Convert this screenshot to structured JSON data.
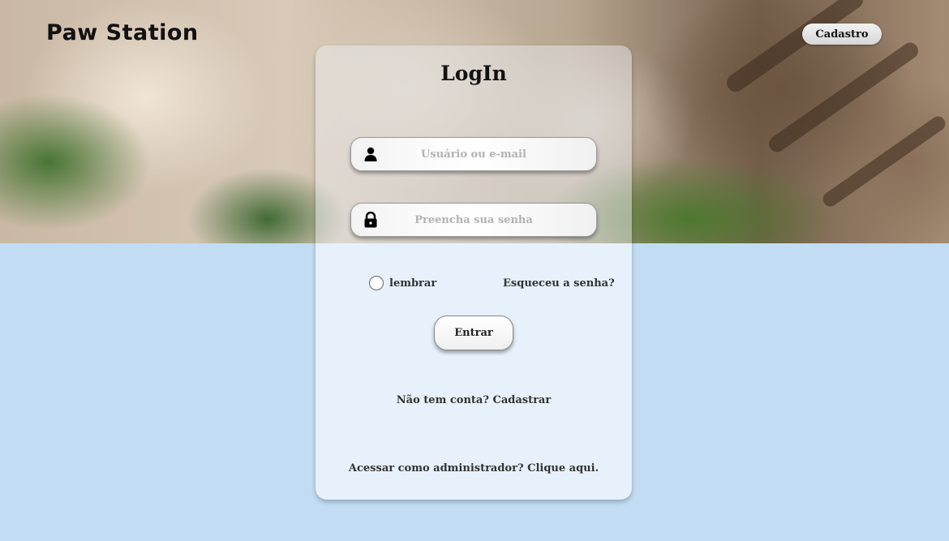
{
  "header": {
    "brand": "Paw Station",
    "signup_label": "Cadastro"
  },
  "login": {
    "title": "LogIn",
    "user_placeholder": "Usuário ou e-mail",
    "password_placeholder": "Preencha sua senha",
    "remember_label": "lembrar",
    "forgot_label": "Esqueceu a senha?",
    "enter_label": "Entrar",
    "register_link": "Não tem conta? Cadastrar",
    "admin_link": "Acessar como administrador? Clique aqui."
  },
  "icons": {
    "user": "user-icon",
    "lock": "lock-icon"
  },
  "colors": {
    "background": "#c2ddf3",
    "card": "#e6f1fb",
    "text": "#333333"
  }
}
